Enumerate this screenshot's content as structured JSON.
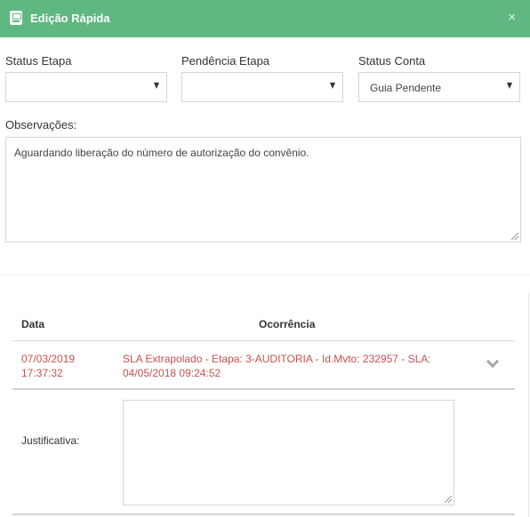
{
  "header": {
    "title": "Edição Rápida",
    "close_symbol": "×",
    "icon": "clipboard-icon",
    "color": "#5fb880"
  },
  "form": {
    "status_etapa": {
      "label": "Status Etapa",
      "value": ""
    },
    "pendencia_etapa": {
      "label": "Pendência Etapa",
      "value": ""
    },
    "status_conta": {
      "label": "Status Conta",
      "value": "Guia Pendente"
    },
    "observacoes": {
      "label": "Observações:",
      "value": "Aguardando liberação do número de autorização do convênio."
    }
  },
  "table": {
    "headers": {
      "date": "Data",
      "occurrence": "Ocorrência"
    },
    "rows": [
      {
        "date_line1": "07/03/2019",
        "date_line2": "17:37:32",
        "occ_line1": "SLA Extrapolado - Etapa: 3-AUDITORIA - Id.Mvto: 232957 - SLA:",
        "occ_line2": "04/05/2018 09:24:52",
        "text_color": "#c9514d"
      }
    ],
    "justificativa": {
      "label": "Justificativa:",
      "value": ""
    }
  }
}
